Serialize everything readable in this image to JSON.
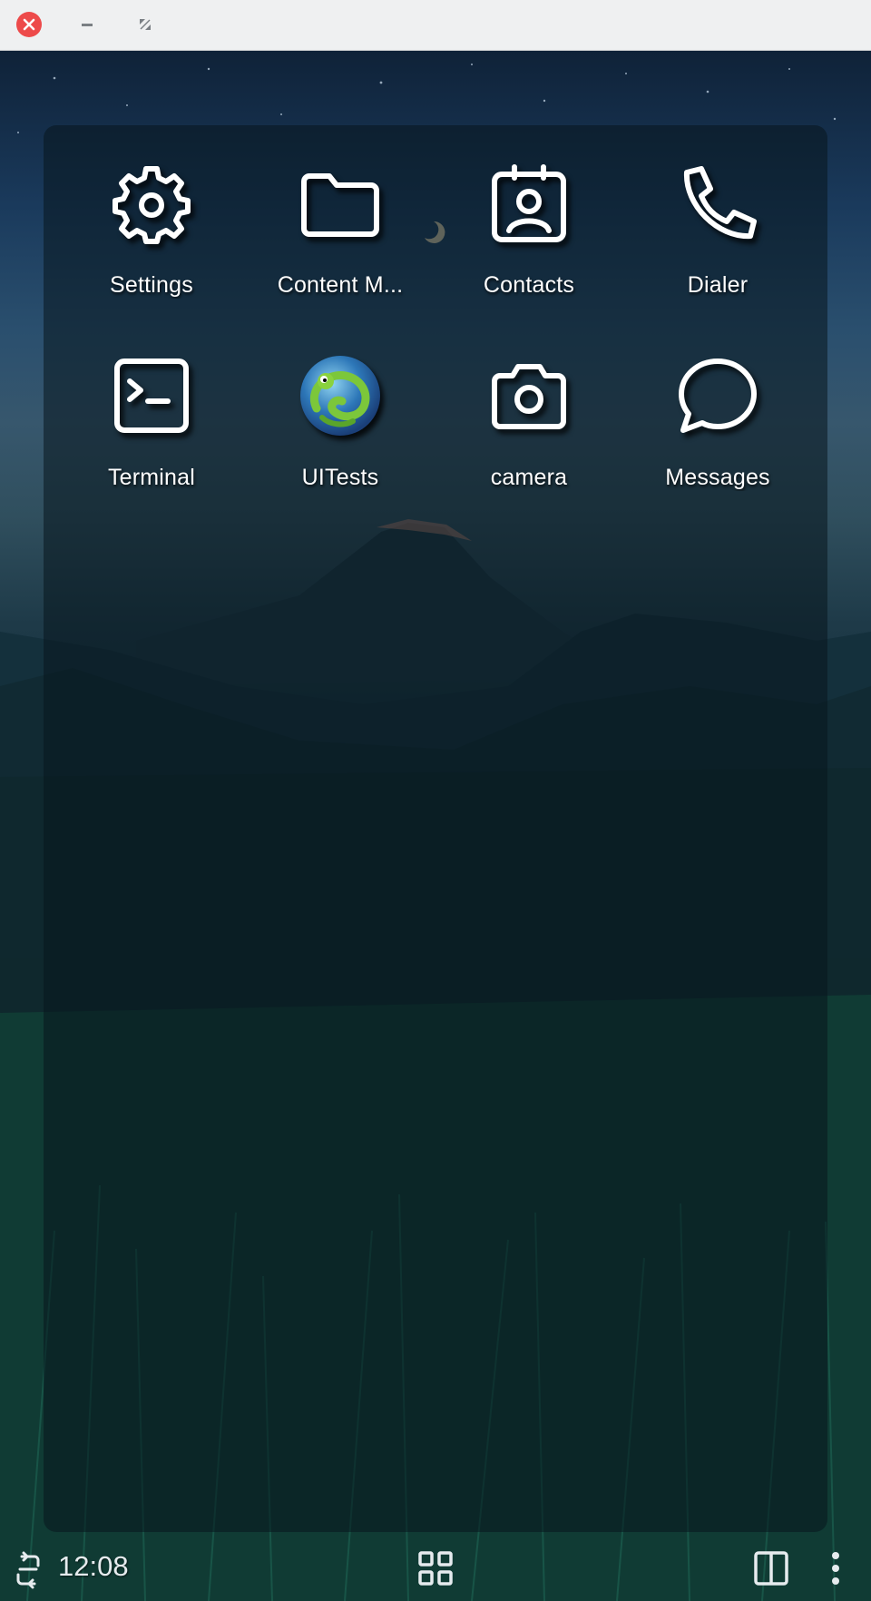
{
  "window": {
    "controls": {
      "close_icon": "close-icon",
      "minimize_icon": "minimize-icon",
      "maximize_icon": "maximize-icon"
    }
  },
  "apps": [
    {
      "label": "Settings",
      "icon": "gear-icon"
    },
    {
      "label": "Content M...",
      "icon": "folder-icon"
    },
    {
      "label": "Contacts",
      "icon": "contact-card-icon"
    },
    {
      "label": "Dialer",
      "icon": "phone-icon"
    },
    {
      "label": "Terminal",
      "icon": "terminal-icon"
    },
    {
      "label": "UITests",
      "icon": "gecko-icon"
    },
    {
      "label": "camera",
      "icon": "camera-icon"
    },
    {
      "label": "Messages",
      "icon": "chat-bubble-icon"
    }
  ],
  "taskbar": {
    "clock": "12:08",
    "rotate_icon": "screen-rotate-icon",
    "app_grid_icon": "app-grid-icon",
    "split_view_icon": "split-view-icon",
    "menu_icon": "more-vertical-icon"
  },
  "colors": {
    "titlebar": "#eff0f1",
    "close_button": "#ed4a4a",
    "icon_foreground": "#ffffff",
    "label_text": "#ffffff"
  }
}
